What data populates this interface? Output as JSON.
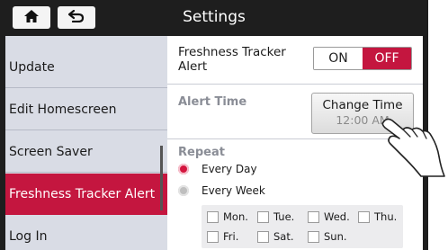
{
  "header": {
    "title": "Settings",
    "home_icon": "home-icon",
    "back_icon": "back-arrow-icon"
  },
  "colors": {
    "accent": "#c4163f",
    "sidebar_bg": "#d9dce5",
    "titlebar_bg": "#1e1e1e"
  },
  "sidebar": {
    "items": [
      {
        "label": "Update"
      },
      {
        "label": "Edit Homescreen"
      },
      {
        "label": "Screen Saver"
      },
      {
        "label": "Freshness Tracker Alert"
      },
      {
        "label": "Log In"
      }
    ],
    "active_index": 3
  },
  "detail": {
    "tracker": {
      "label": "Freshness Tracker Alert",
      "on_label": "ON",
      "off_label": "OFF",
      "selected": "OFF"
    },
    "alert_time": {
      "label": "Alert Time",
      "button_label": "Change Time",
      "value": "12:00 AM"
    },
    "repeat": {
      "label": "Repeat",
      "options": [
        {
          "label": "Every Day",
          "selected": true
        },
        {
          "label": "Every Week",
          "selected": false
        }
      ],
      "days": [
        {
          "label": "Mon.",
          "checked": false
        },
        {
          "label": "Tue.",
          "checked": false
        },
        {
          "label": "Wed.",
          "checked": false
        },
        {
          "label": "Thu.",
          "checked": false
        },
        {
          "label": "Fri.",
          "checked": false
        },
        {
          "label": "Sat.",
          "checked": false
        },
        {
          "label": "Sun.",
          "checked": false
        }
      ]
    }
  },
  "overlay_icon": "pointing-hand-icon"
}
